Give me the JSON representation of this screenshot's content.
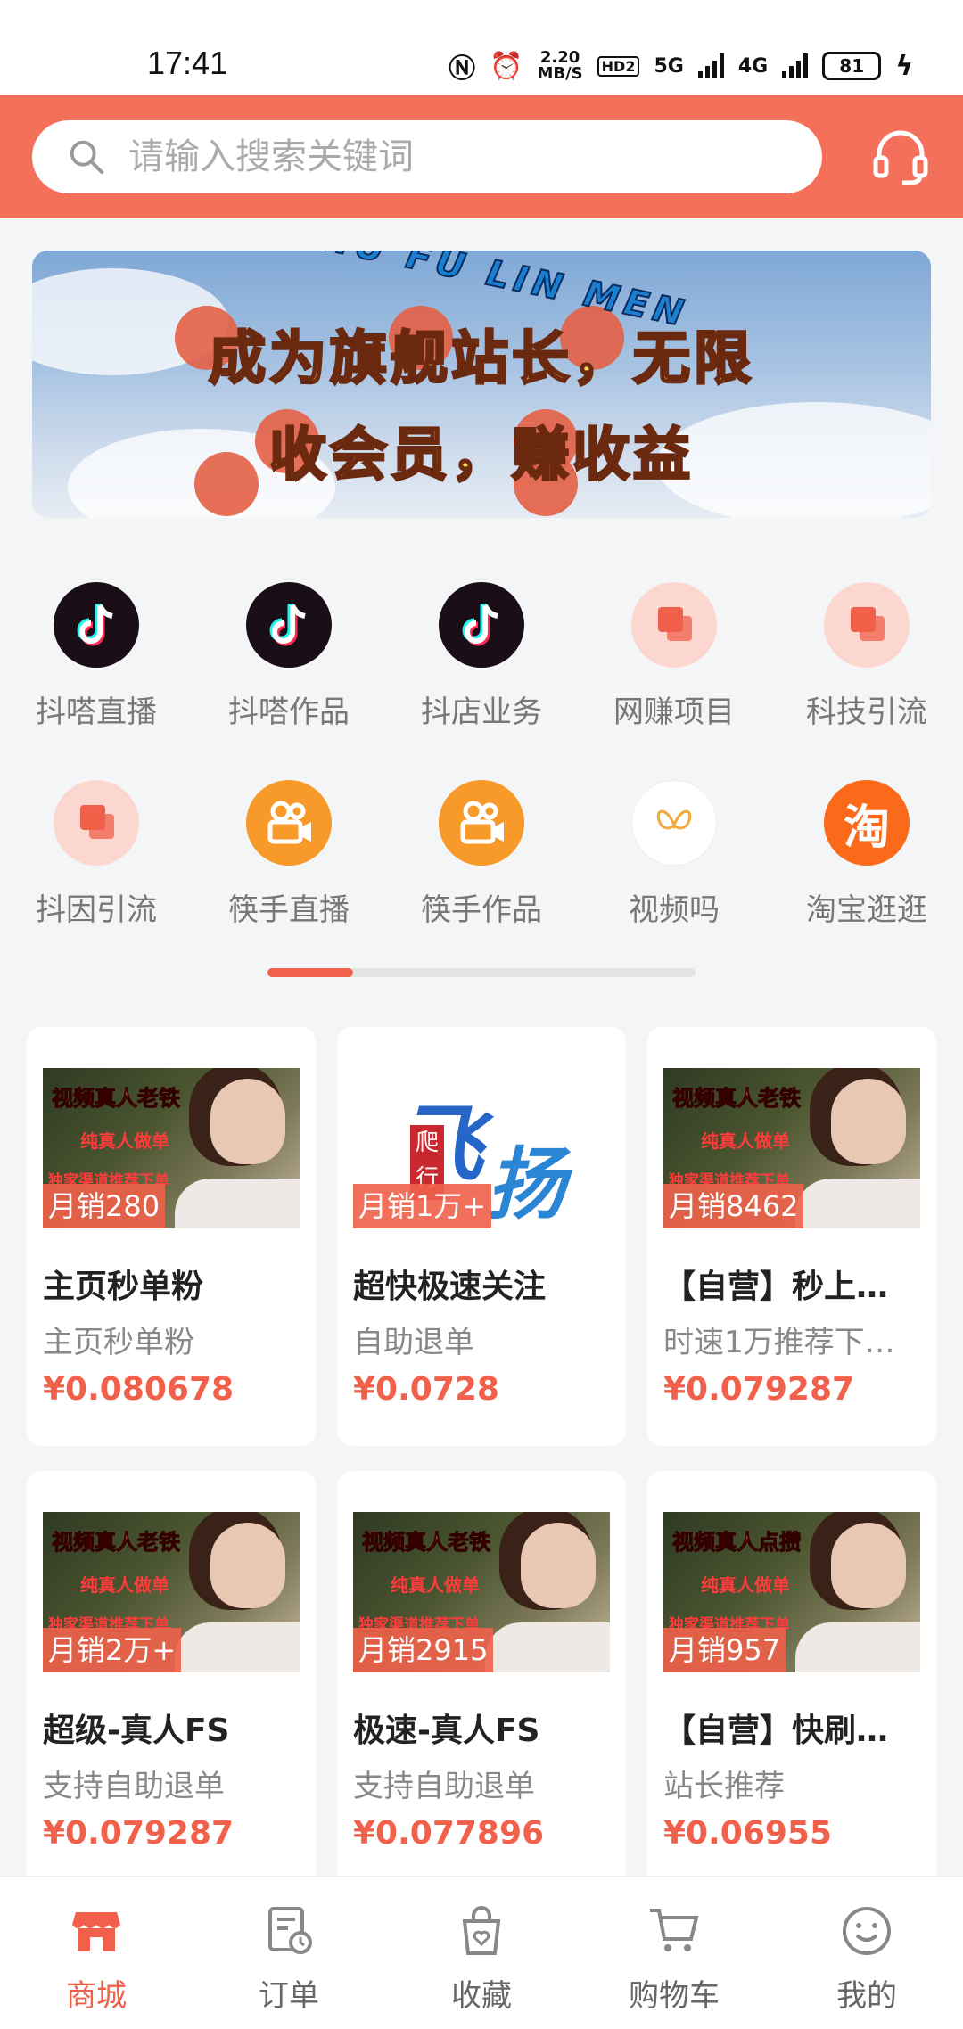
{
  "status_bar": {
    "time": "17:41",
    "net_speed_top": "2.20",
    "net_speed_bottom": "MB/S",
    "hd_label": "HD2",
    "sim1": "5G",
    "sim2": "4G",
    "battery": "81"
  },
  "header": {
    "search_placeholder": "请输入搜索关键词",
    "support_icon": "headset-icon"
  },
  "banner": {
    "subtitle": "HU FU LIN MEN",
    "line1": "成为旗舰站长，无限",
    "line2": "收会员，赚收益"
  },
  "categories": [
    {
      "label": "抖嗒直播",
      "icon": "tiktok-icon"
    },
    {
      "label": "抖嗒作品",
      "icon": "tiktok-icon"
    },
    {
      "label": "抖店业务",
      "icon": "tiktok-icon"
    },
    {
      "label": "网赚项目",
      "icon": "square-icon"
    },
    {
      "label": "科技引流",
      "icon": "square-icon"
    },
    {
      "label": "抖因引流",
      "icon": "square-icon"
    },
    {
      "label": "筷手直播",
      "icon": "kuaishou-icon"
    },
    {
      "label": "筷手作品",
      "icon": "kuaishou-icon"
    },
    {
      "label": "视频吗",
      "icon": "butterfly-icon"
    },
    {
      "label": "淘宝逛逛",
      "icon": "taobao-icon",
      "glyph": "淘"
    }
  ],
  "promo_text": {
    "l1": "视频真人老铁",
    "l2": "纯真人做单",
    "l3": "独家渠道推荐下单",
    "l1_alt": "视频真人点攒",
    "fly_a": "飞",
    "fly_b": "扬",
    "seal": "爬行"
  },
  "products": [
    {
      "sales": "月销280",
      "title": "主页秒单粉",
      "subtitle": "主页秒单粉",
      "price": "¥0.080678",
      "thumb": "dark"
    },
    {
      "sales": "月销1万+",
      "title": "超快极速关注",
      "subtitle": "自助退单",
      "price": "¥0.0728",
      "thumb": "light"
    },
    {
      "sales": "月销8462",
      "title": "【自营】秒上…",
      "subtitle": "时速1万推荐下…",
      "price": "¥0.079287",
      "thumb": "dark"
    },
    {
      "sales": "月销2万+",
      "title": "超级-真人FS",
      "subtitle": "支持自助退单",
      "price": "¥0.079287",
      "thumb": "dark"
    },
    {
      "sales": "月销2915",
      "title": "极速-真人FS",
      "subtitle": "支持自助退单",
      "price": "¥0.077896",
      "thumb": "dark"
    },
    {
      "sales": "月销957",
      "title": "【自营】快刷…",
      "subtitle": "站长推荐",
      "price": "¥0.06955",
      "thumb": "dark"
    }
  ],
  "tabbar": [
    {
      "label": "商城",
      "icon": "shop-icon",
      "active": true
    },
    {
      "label": "订单",
      "icon": "order-icon",
      "active": false
    },
    {
      "label": "收藏",
      "icon": "favorite-bag-icon",
      "active": false
    },
    {
      "label": "购物车",
      "icon": "cart-icon",
      "active": false
    },
    {
      "label": "我的",
      "icon": "profile-smile-icon",
      "active": false
    }
  ],
  "colors": {
    "accent": "#f0604a",
    "header_bg": "#f4705a",
    "price": "#f0604a"
  }
}
